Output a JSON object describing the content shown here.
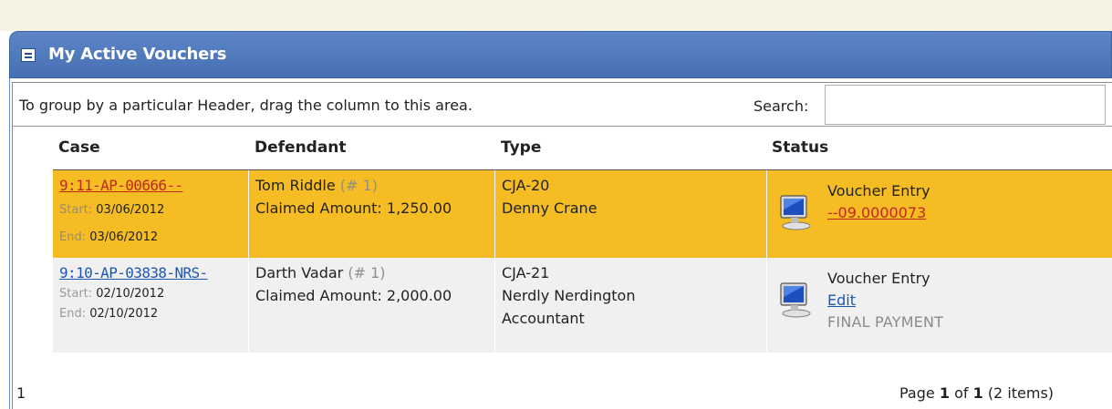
{
  "panel": {
    "title": "My Active Vouchers"
  },
  "toolbar": {
    "group_hint": "To group by a particular Header, drag the column to this area.",
    "search_label": "Search:",
    "search_value": ""
  },
  "columns": [
    "Case",
    "Defendant",
    "Type",
    "Status"
  ],
  "rows": [
    {
      "case": "9:11-AP-00666--",
      "start_label": "Start:",
      "start_date": "03/06/2012",
      "end_label": "End:",
      "end_date": "03/06/2012",
      "defendant": "Tom Riddle",
      "defendant_num": "(# 1)",
      "claimed": "Claimed Amount: 1,250.00",
      "type": "CJA-20",
      "type_line2": "Denny Crane",
      "type_line3": "",
      "status": "Voucher Entry",
      "status_link": "--09.0000073",
      "status_note": ""
    },
    {
      "case": "9:10-AP-03838-NRS-",
      "start_label": "Start:",
      "start_date": "02/10/2012",
      "end_label": "End:",
      "end_date": "02/10/2012",
      "defendant": "Darth Vadar",
      "defendant_num": "(# 1)",
      "claimed": "Claimed Amount: 2,000.00",
      "type": "CJA-21",
      "type_line2": "Nerdly Nerdington",
      "type_line3": "Accountant",
      "status": "Voucher Entry",
      "status_link": "Edit",
      "status_note": "FINAL PAYMENT"
    }
  ],
  "footer": {
    "page_number": "1",
    "pager_prefix": "Page",
    "current_page": "1",
    "of_word": "of",
    "total_pages": "1",
    "items": "(2 items)"
  },
  "colors": {
    "header_blue": "#4670b4",
    "selected_row": "#f5bd23",
    "alt_row": "#f0f0f0",
    "link_blue": "#1a57b5",
    "link_red": "#c0281e"
  },
  "icons": [
    "collapse-icon",
    "computer-monitor-icon"
  ]
}
